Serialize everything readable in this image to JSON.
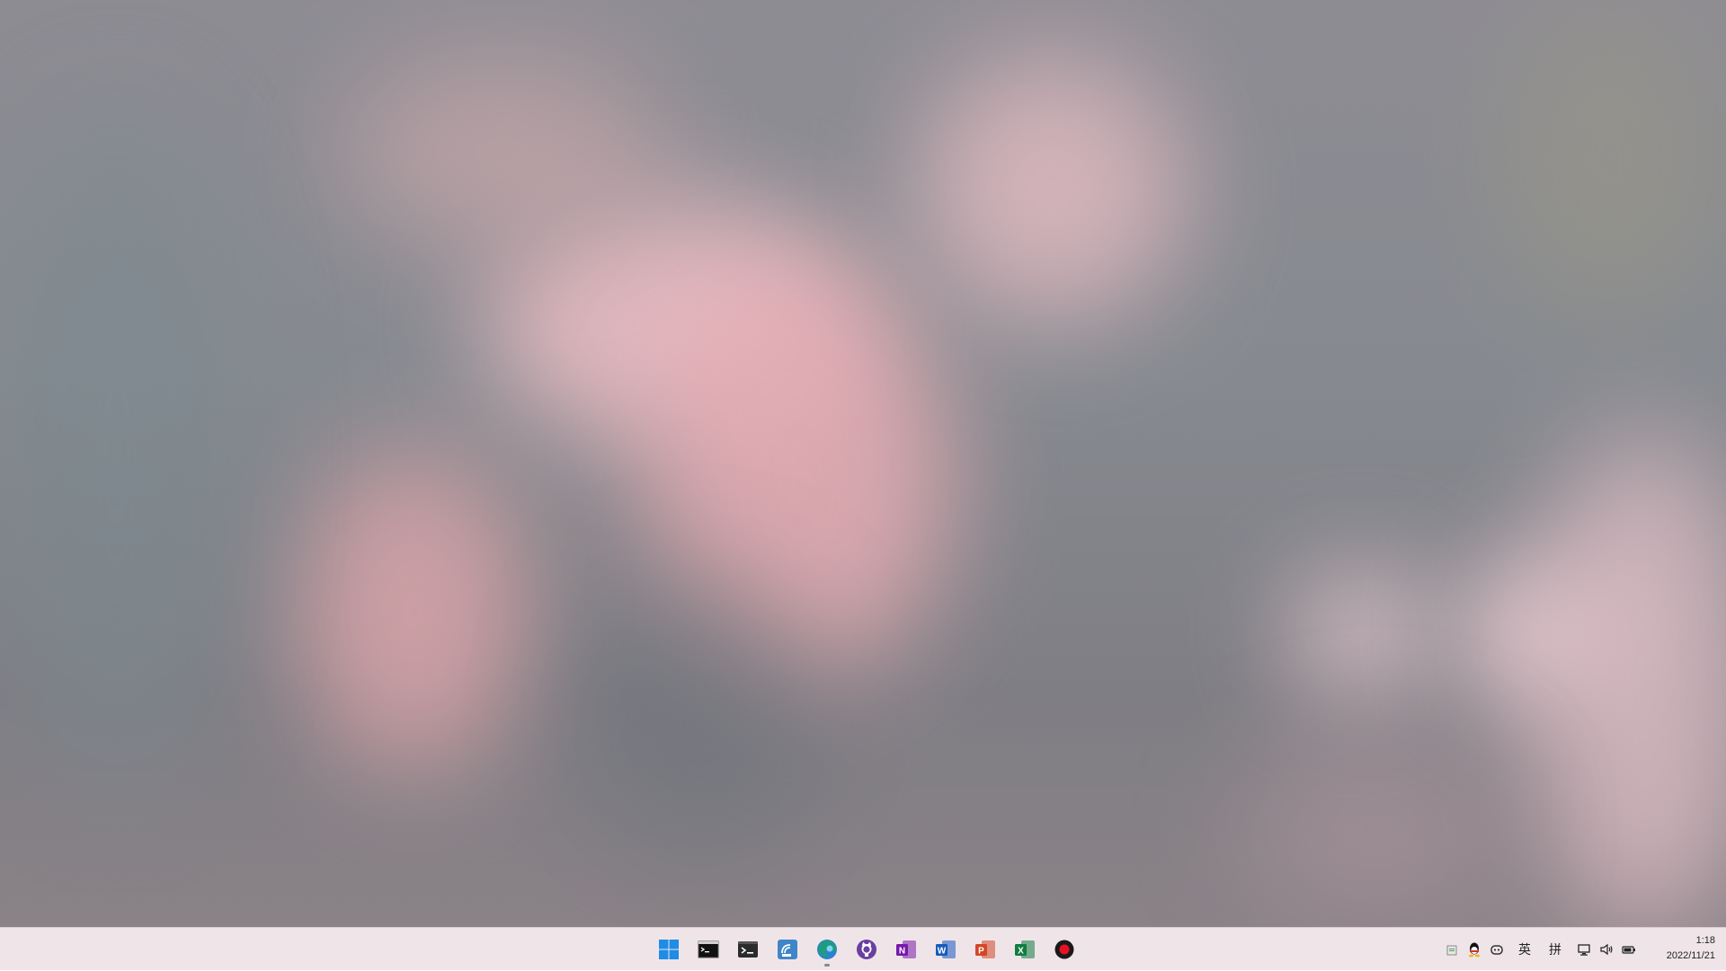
{
  "desktop": {
    "wallpaper_colors": [
      "#8e8c93",
      "#e9b2b8",
      "#e1b9c0",
      "#f3d1d8",
      "#7b868f"
    ]
  },
  "taskbar": {
    "pinned": [
      {
        "id": "start",
        "icon": "windows-start-icon",
        "color": "#1f8ce6"
      },
      {
        "id": "command-prompt",
        "icon": "command-prompt-icon",
        "color": "#111111"
      },
      {
        "id": "terminal",
        "icon": "terminal-icon",
        "color": "#2b2b2b"
      },
      {
        "id": "remote-tool",
        "icon": "satellite-dish-icon",
        "color": "#3f86c8"
      },
      {
        "id": "edge",
        "icon": "edge-browser-icon",
        "color": "#1e9b80",
        "running": true
      },
      {
        "id": "github",
        "icon": "github-icon",
        "color": "#6a3fa0"
      },
      {
        "id": "onenote",
        "icon": "onenote-icon",
        "color": "#7719aa",
        "letter": "N"
      },
      {
        "id": "word",
        "icon": "word-icon",
        "color": "#185abd",
        "letter": "W"
      },
      {
        "id": "powerpoint",
        "icon": "powerpoint-icon",
        "color": "#d24726",
        "letter": "P"
      },
      {
        "id": "excel",
        "icon": "excel-icon",
        "color": "#107c41",
        "letter": "X"
      },
      {
        "id": "recorder",
        "icon": "record-icon",
        "color": "#e81123"
      }
    ],
    "tray": {
      "ime_lang": "英",
      "ime_mode": "拼"
    },
    "clock": {
      "time": "1:18",
      "date": "2022/11/21"
    }
  }
}
